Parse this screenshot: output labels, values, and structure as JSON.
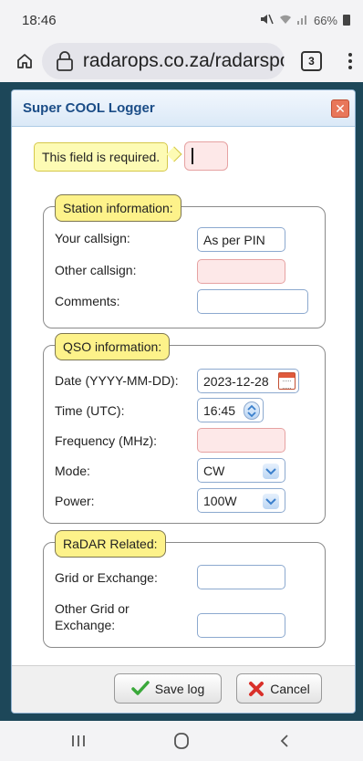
{
  "status_bar": {
    "time": "18:46",
    "battery": "66%"
  },
  "browser": {
    "url": "radarops.co.za/radarspor",
    "tab_count": "3"
  },
  "dialog": {
    "title": "Super COOL Logger",
    "tooltip": "This field is required.",
    "station_section": {
      "legend": "Station information:",
      "your_callsign_label": "Your callsign:",
      "your_callsign_value": "As per PIN",
      "other_callsign_label": "Other callsign:",
      "other_callsign_value": "",
      "comments_label": "Comments:",
      "comments_value": ""
    },
    "qso_section": {
      "legend": "QSO information:",
      "date_label": "Date (YYYY-MM-DD):",
      "date_value": "2023-12-28",
      "time_label": "Time (UTC):",
      "time_value": "16:45",
      "frequency_label": "Frequency (MHz):",
      "frequency_value": "",
      "mode_label": "Mode:",
      "mode_value": "CW",
      "power_label": "Power:",
      "power_value": "100W"
    },
    "radar_section": {
      "legend": "RaDAR Related:",
      "grid_label": "Grid or Exchange:",
      "grid_value": "",
      "other_grid_label_1": "Other Grid or",
      "other_grid_label_2": "Exchange:",
      "other_grid_value": ""
    },
    "footer": {
      "save_label": "Save log",
      "cancel_label": "Cancel"
    }
  },
  "colors": {
    "page_background": "#1d4759",
    "legend_fill": "#fdf28a",
    "tooltip_fill": "#fdfbb4",
    "required_field": "#fde8e8",
    "title_text": "#1b4d87"
  }
}
